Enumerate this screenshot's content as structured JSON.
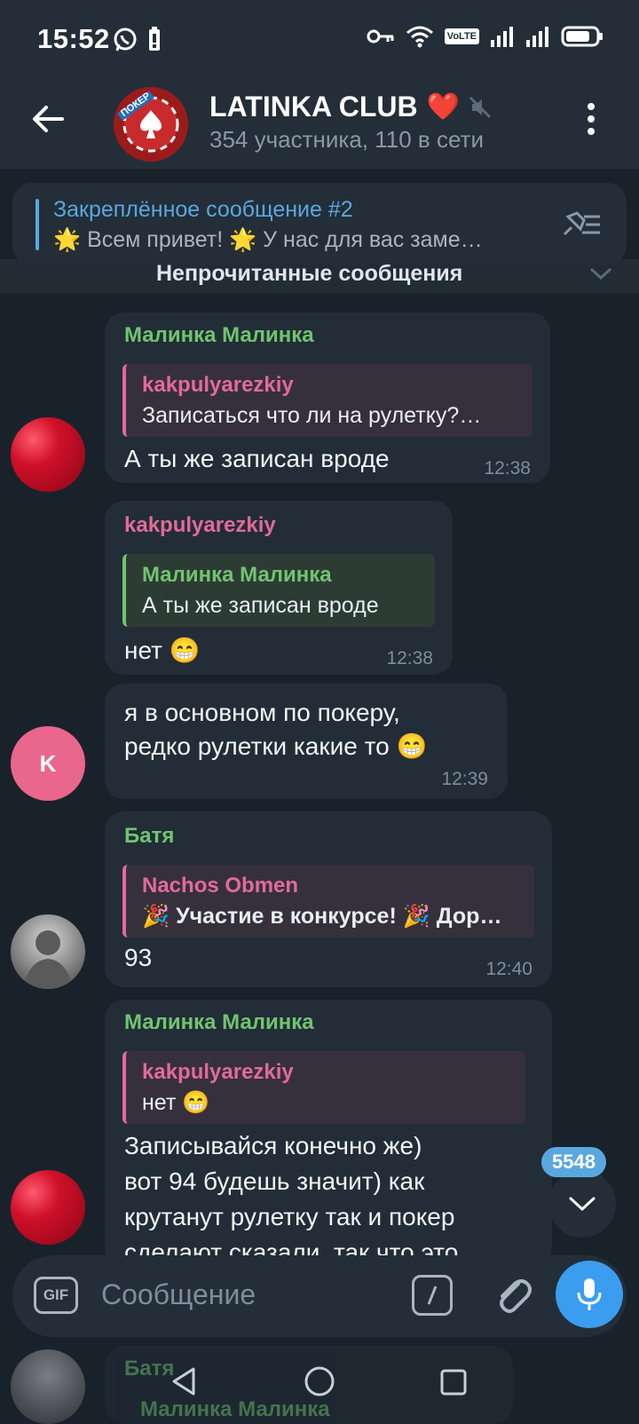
{
  "status_bar": {
    "time": "15:52",
    "network": "VoLTE"
  },
  "header": {
    "title": "LATINKA CLUB",
    "emoji": "❤️",
    "subtitle": "354 участника, 110 в сети",
    "avatar_label": "ПОКЕР"
  },
  "pinned": {
    "title": "Закреплённое сообщение #2",
    "text": "🌟 Всем привет! 🌟  У нас для вас заме…"
  },
  "unread_label": "Непрочитанные сообщения",
  "messages": [
    {
      "author": "Малинка Малинка",
      "reply_author": "kakpulyarezkiy",
      "reply_text": "Записаться что ли на рулетку?…",
      "text": "А ты же записан вроде",
      "time": "12:38"
    },
    {
      "author": "kakpulyarezkiy",
      "reply_author": "Малинка Малинка",
      "reply_text": "А ты же записан вроде",
      "text": "нет 😁",
      "time": "12:38"
    },
    {
      "avatar_letter": "K",
      "line1": "я в основном по покеру,",
      "line2": "редко рулетки какие то 😁",
      "time": "12:39"
    },
    {
      "author": "Батя",
      "reply_author": "Nachos Obmen",
      "reply_text": "🎉 Участие в конкурсе! 🎉 Дор…",
      "text": "93",
      "time": "12:40"
    },
    {
      "author": "Малинка Малинка",
      "reply_author": "kakpulyarezkiy",
      "reply_text": "нет 😁",
      "line1": "Записывайся конечно же)",
      "line2": "вот 94 будешь значит) как",
      "line3": "крутанут рулетку так и покер",
      "line4": "сделают сказали, так что это"
    }
  ],
  "unread_count": "5548",
  "input": {
    "placeholder": "Сообщение",
    "gif_label": "GIF"
  },
  "partial": {
    "author": "Батя",
    "reply_author": "Малинка Малинка"
  }
}
